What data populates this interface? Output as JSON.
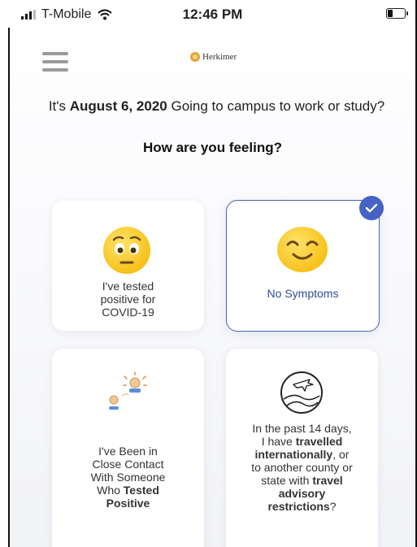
{
  "status_bar": {
    "carrier": "T-Mobile",
    "time": "12:46 PM"
  },
  "header": {
    "logo_text": "Herkimer"
  },
  "intro": {
    "prefix": "It's ",
    "date": "August 6, 2020",
    "suffix": " Going to campus to work or study?",
    "question": "How are you feeling?"
  },
  "cards": {
    "positive": {
      "label": "I've tested positive for COVID-19",
      "selected": false,
      "icon": "worried-face-icon"
    },
    "no_symptoms": {
      "label": "No Symptoms",
      "selected": true,
      "icon": "smiling-face-icon"
    },
    "close_contact": {
      "line1": "I've Been in Close Contact With Someone Who ",
      "bold": "Tested Positive",
      "selected": false,
      "icon": "close-contact-icon"
    },
    "travel": {
      "part1": "In the past 14 days, I have ",
      "bold1": "travelled internationally",
      "part2": ", or to another county or state with ",
      "bold2": "travel advisory restrictions",
      "part3": "?",
      "selected": false,
      "icon": "globe-plane-icon"
    }
  },
  "colors": {
    "accent": "#4562c4",
    "selected_text": "#2f4a9e",
    "emoji": "#f6c21a"
  }
}
